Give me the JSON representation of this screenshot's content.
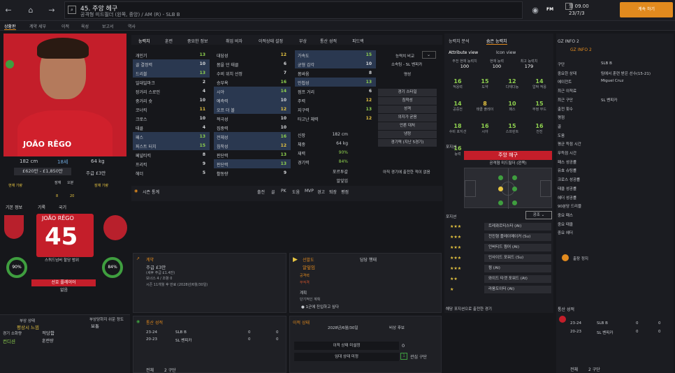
{
  "topbar": {
    "title": "45. 주앙 헤구",
    "subtitle": "공격형 미드필더 (왼쪽, 중앙) / AM (R) - SLB B",
    "date_line1": "월 09.00",
    "date_line2": "23/7/3",
    "continue": "계속 하기",
    "fm": "FM"
  },
  "subnav": [
    "상황판",
    "계약 세부",
    "이적",
    "육성",
    "보고서",
    "역사"
  ],
  "player": {
    "name": "JOÃO RÊGO",
    "number": "45",
    "height": "182 cm",
    "age": "18세",
    "weight": "64 kg",
    "value": "£620만 - £1,850만",
    "wage": "주급 £3만",
    "jersey_name": "JOÃO RÊGO",
    "mood_label": "스쿼드넘버 할당 범위",
    "role_status": "선호 플레이어",
    "role_sub": "없음",
    "ring_left": "90%",
    "ring_right": "84%"
  },
  "bars": [
    {
      "label": "현재 기량",
      "value": ""
    },
    {
      "label": "잠재",
      "value": "8"
    },
    {
      "label": "오분",
      "value": "20"
    },
    {
      "label": "잠재 기량",
      "value": ""
    }
  ],
  "left_tabs": [
    "기본 정보",
    "기록",
    "국기"
  ],
  "left_bottom": [
    "부상 상태",
    "평상시 느낌",
    "보통",
    "적당함",
    "경기 소화량",
    "컨디션",
    "훈련량",
    "부상당하지 쉬운 정도"
  ],
  "attrs_col1": [
    {
      "n": "개인기",
      "v": "13",
      "c": "g"
    },
    {
      "n": "골 결정력",
      "v": "10",
      "c": "w",
      "h": true
    },
    {
      "n": "드리블",
      "v": "13",
      "c": "g",
      "h": true
    },
    {
      "n": "일대일마크",
      "v": "2",
      "c": "w"
    },
    {
      "n": "장거리 스로인",
      "v": "4",
      "c": "w"
    },
    {
      "n": "중거리 슛",
      "v": "10",
      "c": "w"
    },
    {
      "n": "코너킥",
      "v": "11",
      "c": "y"
    },
    {
      "n": "크로스",
      "v": "10",
      "c": "w"
    },
    {
      "n": "태클",
      "v": "4",
      "c": "w"
    },
    {
      "n": "패스",
      "v": "13",
      "c": "g",
      "h": true
    },
    {
      "n": "퍼스트 터치",
      "v": "15",
      "c": "g",
      "h": true
    },
    {
      "n": "페널티킥",
      "v": "8",
      "c": "w"
    },
    {
      "n": "프리킥",
      "v": "9",
      "c": "w"
    },
    {
      "n": "헤더",
      "v": "5",
      "c": "w"
    }
  ],
  "attrs_col2": [
    {
      "n": "대담성",
      "v": "12",
      "c": "y"
    },
    {
      "n": "몸을 던 태클",
      "v": "6",
      "c": "w"
    },
    {
      "n": "수비 위치 선정",
      "v": "7",
      "c": "w"
    },
    {
      "n": "승부욕",
      "v": "16",
      "c": "g"
    },
    {
      "n": "시야",
      "v": "14",
      "c": "g",
      "h": true
    },
    {
      "n": "예측력",
      "v": "10",
      "c": "w",
      "h": true
    },
    {
      "n": "오프 더 볼",
      "v": "12",
      "c": "y",
      "h": true
    },
    {
      "n": "적극성",
      "v": "10",
      "c": "w"
    },
    {
      "n": "집중력",
      "v": "10",
      "c": "w"
    },
    {
      "n": "전체성",
      "v": "16",
      "c": "g",
      "h": true
    },
    {
      "n": "침착성",
      "v": "12",
      "c": "y",
      "h": true
    },
    {
      "n": "판단력",
      "v": "13",
      "c": "g"
    },
    {
      "n": "판단력",
      "v": "13",
      "c": "g",
      "h": true
    },
    {
      "n": "활동량",
      "v": "9",
      "c": "w"
    }
  ],
  "attrs_col3": [
    {
      "n": "가속도",
      "v": "15",
      "c": "g",
      "h": true
    },
    {
      "n": "균형 감각",
      "v": "10",
      "c": "w",
      "h": true
    },
    {
      "n": "몸싸움",
      "v": "8",
      "c": "w"
    },
    {
      "n": "민첩성",
      "v": "13",
      "c": "g",
      "h": true
    },
    {
      "n": "점프 거리",
      "v": "6",
      "c": "w"
    },
    {
      "n": "주력",
      "v": "12",
      "c": "y"
    },
    {
      "n": "지구력",
      "v": "13",
      "c": "g"
    },
    {
      "n": "타고난 체력",
      "v": "12",
      "c": "y"
    }
  ],
  "attr_header": {
    "tabs": [
      "능력치",
      "훈련",
      "중요한 정보",
      "취업 비자",
      "이적상태 설정",
      "부상",
      "통산 성적",
      "피드백"
    ],
    "compare": "능력치 비교",
    "club": "소속팀 - SL 벤피카"
  },
  "phys": [
    {
      "k": "신장",
      "v": "182 cm"
    },
    {
      "k": "체중",
      "v": "64 kg"
    },
    {
      "k": "재력",
      "v": "90%"
    },
    {
      "k": "경기력",
      "v": "84%"
    },
    {
      "k": "",
      "v": "포르투갈"
    },
    {
      "k": "",
      "v": "알잎임"
    }
  ],
  "side_btns": [
    "명성",
    "경기 스타일",
    "침착성",
    "성격",
    "의지가 굳음",
    "언론 대처",
    "냉정",
    "경기력 (지난 5경기)"
  ],
  "side_note": "아직 경기에 출전한 적이 없음",
  "stats_header": [
    "시즌 통계",
    "",
    "출전",
    "골",
    "PK",
    "도움",
    "MVP",
    "경고",
    "퇴장",
    "평점"
  ],
  "contract": {
    "head": "계약",
    "line1": "주급 £3만",
    "line2": "(세후 주급 £1.4만)",
    "line3": "보너스 4 / 조항 0",
    "line4": "시즌 11개월 후 만료 (2028년/6월/30일)"
  },
  "scout": {
    "head": "선발도",
    "title": "담당 행태",
    "sub1": "알잎임",
    "sub2": "공격력",
    "sub3": "부적격",
    "plan": "계획",
    "plan2": "단기적인 계획",
    "plan3": "1군에 진입하고 싶다"
  },
  "history": {
    "head": "통산 성적",
    "rows": [
      {
        "y": "23-24",
        "club": "SLB B",
        "a": "0",
        "b": "0"
      },
      {
        "y": "20-23",
        "club": "SL 벤피카",
        "a": "0",
        "b": "0"
      }
    ],
    "total": "전체",
    "total_v": "2 구단"
  },
  "transfer": {
    "head": "이적 상태",
    "date": "2028년/6월/30일",
    "c1": "비상 후보",
    "r1": "이적 상태 미설정",
    "r1v": "0",
    "r2": "임대 상태 미정",
    "r2v": "1",
    "r2s": "관심 구단"
  },
  "right": {
    "tabs": [
      "능력치 분석",
      "숨은 능력치"
    ],
    "sub": [
      "Attribute view",
      "Icon view"
    ],
    "top": [
      {
        "l": "주전 현재 능력치",
        "v": "100"
      },
      {
        "l": "현재 능력",
        "v": "100"
      },
      {
        "l": "최고 능력치",
        "v": "179"
      }
    ],
    "grid": [
      {
        "n": "16",
        "l": "적응력"
      },
      {
        "n": "15",
        "l": "도약"
      },
      {
        "n": "12",
        "l": "다재다능"
      },
      {
        "n": "14",
        "l": "압박 적응"
      },
      {
        "n": "14",
        "l": "공중전"
      },
      {
        "n": "8",
        "l": "태클 플레이"
      },
      {
        "n": "10",
        "l": "패스"
      },
      {
        "n": "15",
        "l": "부정 부드"
      },
      {
        "n": "18",
        "l": "수비 포지션"
      },
      {
        "n": "16",
        "l": "시야"
      },
      {
        "n": "15",
        "l": "스프린트"
      },
      {
        "n": "16",
        "l": "전진"
      },
      {
        "n": "16",
        "l": "능력"
      }
    ],
    "pos_head": "포지션",
    "pos_box": "주앙 헤구",
    "pos_sub": "공격형 미드필더 (왼쪽)",
    "role_head": "포지션",
    "role_sel": "공조",
    "roles": [
      {
        "s": "★★★",
        "n": "트레콰르티스타 (At)"
      },
      {
        "s": "★★★",
        "n": "전진형 플레이메이커 (Su)"
      },
      {
        "s": "★★★",
        "n": "인버티드 윙어 (At)"
      },
      {
        "s": "★★★",
        "n": "인사이드 포워드 (Su)"
      },
      {
        "s": "★★★",
        "n": "윙 (At)"
      },
      {
        "s": "★★",
        "n": "와이드 타겟 포워드 (At)"
      },
      {
        "s": "★",
        "n": "라움도이터 (At)"
      }
    ],
    "bottom": "해당 포지션으로 출전한 경기"
  },
  "info": {
    "head": "GZ INFO 2",
    "sub": "GZ INFO 2",
    "rows": [
      {
        "k": "구단",
        "v": "SLB B"
      },
      {
        "k": "중요한 상태",
        "v": "팀에서 훈련 받은 선수(15-21)"
      },
      {
        "k": "에이전트",
        "v": "Miguel Cruz"
      },
      {
        "k": "최근 이적료",
        "v": ""
      },
      {
        "k": "최근 구단",
        "v": "SL 벤피카"
      },
      {
        "k": "출전 횟수",
        "v": ""
      },
      {
        "k": "평점",
        "v": ""
      },
      {
        "k": "골",
        "v": ""
      },
      {
        "k": "도움",
        "v": ""
      },
      {
        "k": "평균 득점 시간",
        "v": ""
      },
      {
        "k": "무득점 시간",
        "v": ""
      },
      {
        "k": "패스 성공률",
        "v": ""
      },
      {
        "k": "유효 슈팅률",
        "v": ""
      },
      {
        "k": "크로스 성공률",
        "v": ""
      },
      {
        "k": "태클 성공률",
        "v": ""
      },
      {
        "k": "헤더 성공률",
        "v": ""
      },
      {
        "k": "90분당 드리블",
        "v": ""
      },
      {
        "k": "중요 패스",
        "v": ""
      },
      {
        "k": "중요 태클",
        "v": ""
      },
      {
        "k": "중요 헤더",
        "v": ""
      }
    ],
    "stop": "출장 정지",
    "hist_head": "통산 성적",
    "hist": [
      {
        "y": "23-24",
        "club": "SLB B",
        "a": "0",
        "b": "0"
      },
      {
        "y": "20-23",
        "club": "SL 벤피카",
        "a": "0",
        "b": "0"
      }
    ],
    "total": "전체",
    "total_v": "2 구단"
  }
}
